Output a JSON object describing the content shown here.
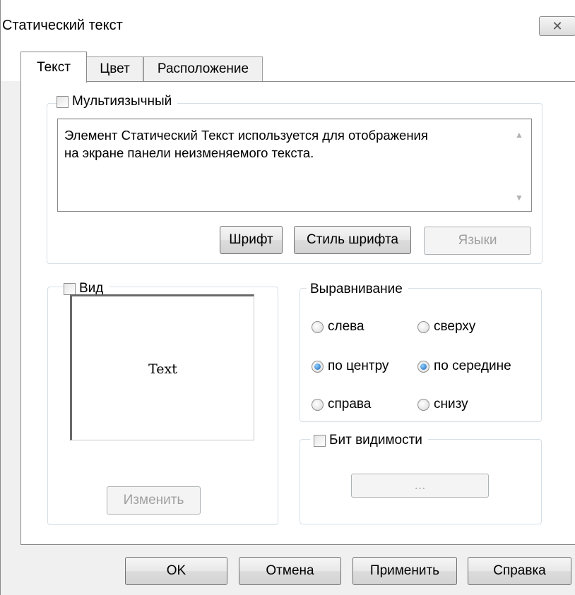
{
  "window": {
    "title": "Статический текст",
    "close_symbol": "✕"
  },
  "tabs": [
    {
      "label": "Текст",
      "active": true
    },
    {
      "label": "Цвет",
      "active": false
    },
    {
      "label": "Расположение",
      "active": false
    }
  ],
  "multilang": {
    "label": "Мультиязычный",
    "checked": false,
    "text_line1": "Элемент Статический Текст используется для отображения",
    "text_line2": "на экране панели неизменяемого текста.",
    "scroll_up": "▲",
    "scroll_down": "▼"
  },
  "font_buttons": {
    "font": "Шрифт",
    "font_style": "Стиль шрифта",
    "languages": "Языки"
  },
  "view": {
    "label": "Вид",
    "checked": false,
    "preview_text": "Text",
    "change_button": "Изменить"
  },
  "alignment": {
    "label": "Выравнивание",
    "left": "слева",
    "top": "сверху",
    "center": "по центру",
    "middle": "по середине",
    "right": "справа",
    "bottom": "снизу",
    "horizontal_selected": "по центру",
    "vertical_selected": "по середине"
  },
  "visibility": {
    "label": "Бит видимости",
    "checked": false,
    "button": "..."
  },
  "footer": {
    "ok": "OK",
    "cancel": "Отмена",
    "apply": "Применить",
    "help": "Справка"
  },
  "colors": {
    "accent_radio": "#1a62b8",
    "panel_bg": "#ffffff",
    "dialog_bg": "#f0f0f0"
  }
}
